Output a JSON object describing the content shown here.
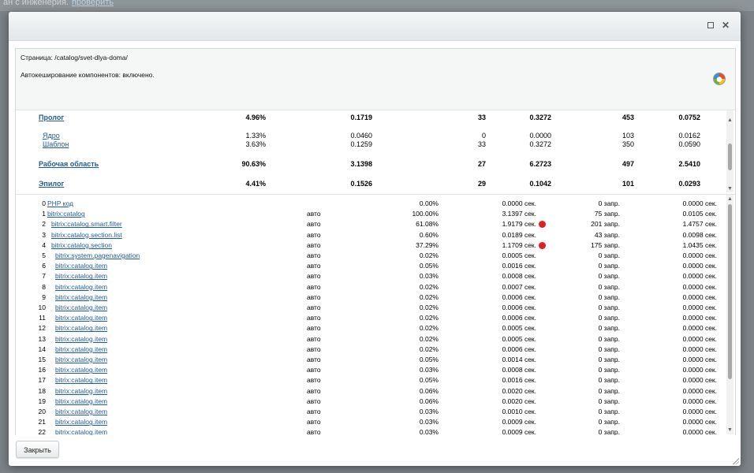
{
  "background": {
    "text": "ан с инженерия.",
    "link": "проверить"
  },
  "window": {
    "maximize_label": "",
    "close_label": "✕"
  },
  "info": {
    "page_line": "Страница: /catalog/svet-dlya-doma/",
    "cache_line": "Автокеширование компонентов: включено."
  },
  "summary": [
    {
      "name": "Пролог",
      "bold": true,
      "pct": "4.96%",
      "time": "0.1719",
      "queries": "33",
      "qtime": "0.3272",
      "c5": "453",
      "c6": "0.0752"
    },
    {
      "name": "Ядро",
      "bold": false,
      "pct": "1.33%",
      "time": "0.0460",
      "queries": "0",
      "qtime": "0.0000",
      "c5": "103",
      "c6": "0.0162"
    },
    {
      "name": "Шаблон",
      "bold": false,
      "pct": "3.63%",
      "time": "0.1259",
      "queries": "33",
      "qtime": "0.3272",
      "c5": "350",
      "c6": "0.0590"
    },
    {
      "name": "Рабочая область",
      "bold": true,
      "pct": "90.63%",
      "time": "3.1398",
      "queries": "27",
      "qtime": "6.2723",
      "c5": "497",
      "c6": "2.5410"
    },
    {
      "name": "Эпилог",
      "bold": true,
      "pct": "4.41%",
      "time": "0.1526",
      "queries": "29",
      "qtime": "0.1042",
      "c5": "101",
      "c6": "0.0293"
    }
  ],
  "components": [
    {
      "n": "0",
      "name": "PHP код",
      "level": 0,
      "cache": "",
      "pct": "0.00%",
      "time": "0.0000 сек.",
      "alert": false,
      "q": "0 запр.",
      "qt": "0.0000 сек."
    },
    {
      "n": "1",
      "name": "bitrix:catalog",
      "level": 0,
      "cache": "авто",
      "pct": "100.00%",
      "time": "3.1397 сек.",
      "alert": false,
      "q": "75 запр.",
      "qt": "0.0105 сек."
    },
    {
      "n": "2",
      "name": "bitrix:catalog.smart.filter",
      "level": 1,
      "cache": "авто",
      "pct": "61.08%",
      "time": "1.9179 сек.",
      "alert": true,
      "q": "201 запр.",
      "qt": "1.4757 сек."
    },
    {
      "n": "3",
      "name": "bitrix:catalog.section.list",
      "level": 1,
      "cache": "авто",
      "pct": "0.60%",
      "time": "0.0189 сек.",
      "alert": false,
      "q": "43 запр.",
      "qt": "0.0098 сек."
    },
    {
      "n": "4",
      "name": "bitrix:catalog.section",
      "level": 1,
      "cache": "авто",
      "pct": "37.29%",
      "time": "1.1709 сек.",
      "alert": true,
      "q": "175 запр.",
      "qt": "1.0435 сек."
    },
    {
      "n": "5",
      "name": "bitrix:system.pagenavigation",
      "level": 2,
      "cache": "авто",
      "pct": "0.02%",
      "time": "0.0005 сек.",
      "alert": false,
      "q": "0 запр.",
      "qt": "0.0000 сек."
    },
    {
      "n": "6",
      "name": "bitrix:catalog.item",
      "level": 2,
      "cache": "авто",
      "pct": "0.05%",
      "time": "0.0016 сек.",
      "alert": false,
      "q": "0 запр.",
      "qt": "0.0000 сек."
    },
    {
      "n": "7",
      "name": "bitrix:catalog.item",
      "level": 2,
      "cache": "авто",
      "pct": "0.03%",
      "time": "0.0008 сек.",
      "alert": false,
      "q": "0 запр.",
      "qt": "0.0000 сек."
    },
    {
      "n": "8",
      "name": "bitrix:catalog.item",
      "level": 2,
      "cache": "авто",
      "pct": "0.02%",
      "time": "0.0007 сек.",
      "alert": false,
      "q": "0 запр.",
      "qt": "0.0000 сек."
    },
    {
      "n": "9",
      "name": "bitrix:catalog.item",
      "level": 2,
      "cache": "авто",
      "pct": "0.02%",
      "time": "0.0006 сек.",
      "alert": false,
      "q": "0 запр.",
      "qt": "0.0000 сек."
    },
    {
      "n": "10",
      "name": "bitrix:catalog.item",
      "level": 2,
      "cache": "авто",
      "pct": "0.02%",
      "time": "0.0006 сек.",
      "alert": false,
      "q": "0 запр.",
      "qt": "0.0000 сек."
    },
    {
      "n": "11",
      "name": "bitrix:catalog.item",
      "level": 2,
      "cache": "авто",
      "pct": "0.02%",
      "time": "0.0006 сек.",
      "alert": false,
      "q": "0 запр.",
      "qt": "0.0000 сек."
    },
    {
      "n": "12",
      "name": "bitrix:catalog.item",
      "level": 2,
      "cache": "авто",
      "pct": "0.02%",
      "time": "0.0005 сек.",
      "alert": false,
      "q": "0 запр.",
      "qt": "0.0000 сек."
    },
    {
      "n": "13",
      "name": "bitrix:catalog.item",
      "level": 2,
      "cache": "авто",
      "pct": "0.02%",
      "time": "0.0005 сек.",
      "alert": false,
      "q": "0 запр.",
      "qt": "0.0000 сек."
    },
    {
      "n": "14",
      "name": "bitrix:catalog.item",
      "level": 2,
      "cache": "авто",
      "pct": "0.02%",
      "time": "0.0006 сек.",
      "alert": false,
      "q": "0 запр.",
      "qt": "0.0000 сек."
    },
    {
      "n": "15",
      "name": "bitrix:catalog.item",
      "level": 2,
      "cache": "авто",
      "pct": "0.05%",
      "time": "0.0014 сек.",
      "alert": false,
      "q": "0 запр.",
      "qt": "0.0000 сек."
    },
    {
      "n": "16",
      "name": "bitrix:catalog.item",
      "level": 2,
      "cache": "авто",
      "pct": "0.03%",
      "time": "0.0008 сек.",
      "alert": false,
      "q": "0 запр.",
      "qt": "0.0000 сек."
    },
    {
      "n": "17",
      "name": "bitrix:catalog.item",
      "level": 2,
      "cache": "авто",
      "pct": "0.05%",
      "time": "0.0016 сек.",
      "alert": false,
      "q": "0 запр.",
      "qt": "0.0000 сек."
    },
    {
      "n": "18",
      "name": "bitrix:catalog.item",
      "level": 2,
      "cache": "авто",
      "pct": "0.06%",
      "time": "0.0020 сек.",
      "alert": false,
      "q": "0 запр.",
      "qt": "0.0000 сек."
    },
    {
      "n": "19",
      "name": "bitrix:catalog.item",
      "level": 2,
      "cache": "авто",
      "pct": "0.06%",
      "time": "0.0020 сек.",
      "alert": false,
      "q": "0 запр.",
      "qt": "0.0000 сек."
    },
    {
      "n": "20",
      "name": "bitrix:catalog.item",
      "level": 2,
      "cache": "авто",
      "pct": "0.03%",
      "time": "0.0010 сек.",
      "alert": false,
      "q": "0 запр.",
      "qt": "0.0000 сек."
    },
    {
      "n": "21",
      "name": "bitrix:catalog.item",
      "level": 2,
      "cache": "авто",
      "pct": "0.03%",
      "time": "0.0009 сек.",
      "alert": false,
      "q": "0 запр.",
      "qt": "0.0000 сек."
    },
    {
      "n": "22",
      "name": "bitrix:catalog.item",
      "level": 2,
      "cache": "авто",
      "pct": "0.03%",
      "time": "0.0009 сек.",
      "alert": false,
      "q": "0 запр.",
      "qt": "0.0000 сек."
    }
  ],
  "footer": {
    "close_label": "Закрыть"
  },
  "colors": {
    "link": "#1e5b9e",
    "alert_dot": "#e02020",
    "title_bar": "#eef1f3"
  },
  "icons": [
    "maximize-icon",
    "close-icon",
    "cache-gauge-icon",
    "scroll-up-icon",
    "scroll-down-icon",
    "resize-grip-icon",
    "alert-dot-icon"
  ]
}
